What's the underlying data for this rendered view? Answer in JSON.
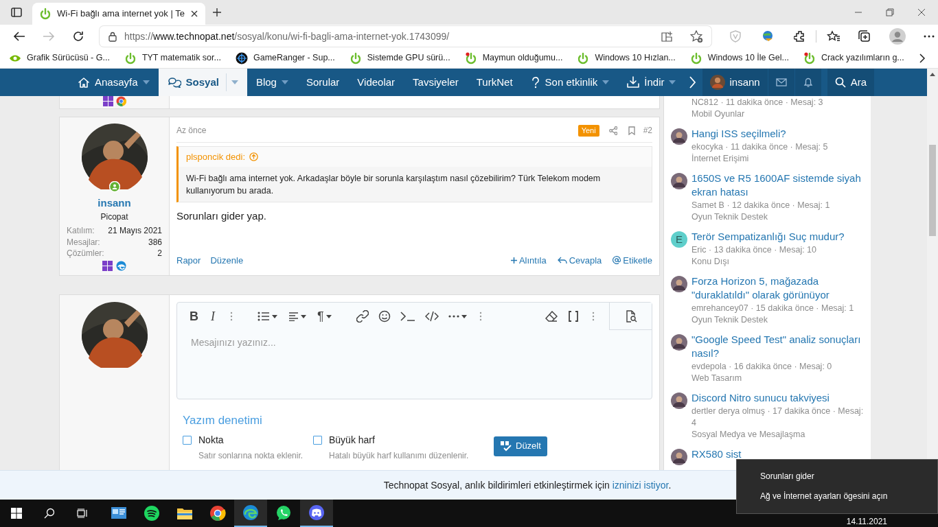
{
  "browser": {
    "tab_title": "Wi-Fi bağlı ama internet yok | Te",
    "url_scheme": "https://",
    "url_domain": "www.technopat.net",
    "url_path": "/sosyal/konu/wi-fi-bagli-ama-internet-yok.1743099/"
  },
  "bookmarks": [
    {
      "kind": "nvidia",
      "label": "Grafik Sürücüsü - G..."
    },
    {
      "kind": "power",
      "label": "TYT matematik sor..."
    },
    {
      "kind": "gameranger",
      "label": "GameRanger - Sup..."
    },
    {
      "kind": "power",
      "label": "Sistemde GPU sürü..."
    },
    {
      "kind": "power-alert",
      "label": "Maymun olduğumu..."
    },
    {
      "kind": "power",
      "label": "Windows 10 Hızlan..."
    },
    {
      "kind": "power",
      "label": "Windows 10 İle Gel..."
    },
    {
      "kind": "power-alert",
      "label": "Crack yazılımların g..."
    }
  ],
  "nav": {
    "items": [
      {
        "label": "Anasayfa",
        "dropdown": true,
        "selected": false
      },
      {
        "label": "Sosyal",
        "dropdown": true,
        "selected": true
      },
      {
        "label": "Blog",
        "dropdown": true,
        "selected": false
      },
      {
        "label": "Sorular",
        "dropdown": false,
        "selected": false
      },
      {
        "label": "Videolar",
        "dropdown": false,
        "selected": false
      },
      {
        "label": "Tavsiyeler",
        "dropdown": false,
        "selected": false
      },
      {
        "label": "TurkNet",
        "dropdown": false,
        "selected": false
      },
      {
        "label": "Son etkinlik",
        "dropdown": true,
        "selected": false
      },
      {
        "label": "İndir",
        "dropdown": true,
        "selected": false
      }
    ],
    "user": "insann",
    "search": "Ara"
  },
  "previous_post": {
    "devices": [
      {
        "kind": "windows"
      },
      {
        "kind": "chrome"
      }
    ]
  },
  "post": {
    "author": {
      "name": "insann",
      "online": true,
      "title": "Picopat",
      "stats": [
        {
          "label": "Katılım:",
          "value": "21 Mayıs 2021"
        },
        {
          "label": "Mesajlar:",
          "value": "386"
        },
        {
          "label": "Çözümler:",
          "value": "2"
        }
      ],
      "devices": [
        {
          "kind": "windows"
        },
        {
          "kind": "edge"
        }
      ]
    },
    "time": "Az önce",
    "badge": "Yeni",
    "number": "#2",
    "quote": {
      "author": "plsponcik dedi:",
      "text": "Wi-Fi bağlı ama internet yok. Arkadaşlar böyle bir sorunla karşılaştım nasıl çözebilirim? Türk Telekom modem kullanıyorum bu arada."
    },
    "body": "Sorunları gider yap.",
    "actions_left": [
      "Rapor",
      "Düzenle"
    ],
    "actions_right": [
      {
        "kind": "plus",
        "label": "Alıntıla"
      },
      {
        "kind": "reply",
        "label": "Cevapla"
      },
      {
        "kind": "at",
        "label": "Etiketle"
      }
    ]
  },
  "editor": {
    "toolbar": [
      {
        "kind": "bold",
        "label": "B"
      },
      {
        "kind": "italic",
        "label": "I"
      },
      {
        "kind": "dots"
      },
      {
        "kind": "list",
        "dropdown": true
      },
      {
        "kind": "align",
        "dropdown": true
      },
      {
        "kind": "paragraph",
        "label": "¶",
        "dropdown": true
      },
      {
        "kind": "link"
      },
      {
        "kind": "smile"
      },
      {
        "kind": "terminal"
      },
      {
        "kind": "code"
      },
      {
        "kind": "more",
        "dropdown": true
      },
      {
        "kind": "dots"
      },
      {
        "kind": "eraser"
      },
      {
        "kind": "brackets"
      },
      {
        "kind": "dots"
      }
    ],
    "placeholder": "Mesajınızı yazınız..."
  },
  "spellcheck": {
    "title": "Yazım denetimi",
    "options": [
      {
        "label": "Nokta",
        "hint": "Satır sonlarına nokta eklenir.",
        "checked": false
      },
      {
        "label": "Büyük harf",
        "hint": "Hatalı büyük harf kullanımı düzenlenir.",
        "checked": false
      }
    ],
    "button": "Düzelt"
  },
  "sidebar": {
    "items": [
      {
        "meta": "NC812 · 11 dakika önce · Mesaj: 3",
        "forum": "Mobil Oyunlar"
      },
      {
        "kind": "photo",
        "title": "Hangi ISS seçilmeli?",
        "meta": "ekocyka · 11 dakika önce · Mesaj: 5",
        "forum": "İnternet Erişimi"
      },
      {
        "kind": "photo",
        "title": "1650S ve R5 1600AF sistemde siyah ekran hatası",
        "meta": "Samet B · 12 dakika önce · Mesaj: 1",
        "forum": "Oyun Teknik Destek"
      },
      {
        "kind": "letter",
        "letter": "E",
        "title": "Terör Sempatizanlığı Suç mudur?",
        "meta": "Eric · 13 dakika önce · Mesaj: 10",
        "forum": "Konu Dışı"
      },
      {
        "kind": "photo",
        "title": "Forza Horizon 5, mağazada \"duraklatıldı\" olarak görünüyor",
        "meta": "emrehancey07 · 15 dakika önce · Mesaj: 1",
        "forum": "Oyun Teknik Destek"
      },
      {
        "kind": "photo",
        "title": "\"Google Speed Test\" analiz sonuçları nasıl?",
        "meta": "evdepola · 16 dakika önce · Mesaj: 0",
        "forum": "Web Tasarım"
      },
      {
        "kind": "photo",
        "title": "Discord Nitro sunucu takviyesi",
        "meta": "dertler derya olmuş · 17 dakika önce · Mesaj: 4",
        "forum": "Sosyal Medya ve Mesajlaşma"
      },
      {
        "kind": "photo",
        "title": "RX580 sist"
      }
    ]
  },
  "notification": {
    "text": "Technopat Sosyal, anlık bildirimleri etkinleştirmek için ",
    "link": "izninizi istiyor",
    "end": "."
  },
  "taskbar": {
    "apps": [
      {
        "kind": "control-panel",
        "running": false
      },
      {
        "kind": "spotify",
        "running": false
      },
      {
        "kind": "explorer",
        "running": false
      },
      {
        "kind": "chrome",
        "running": false
      },
      {
        "kind": "edge",
        "running": true
      },
      {
        "kind": "whatsapp",
        "running": false
      },
      {
        "kind": "discord",
        "running": true
      }
    ],
    "date": "14.11.2021"
  },
  "context_menu": {
    "items": [
      "Sorunları gider",
      "Ağ ve İnternet ayarları ögesini açın"
    ]
  }
}
